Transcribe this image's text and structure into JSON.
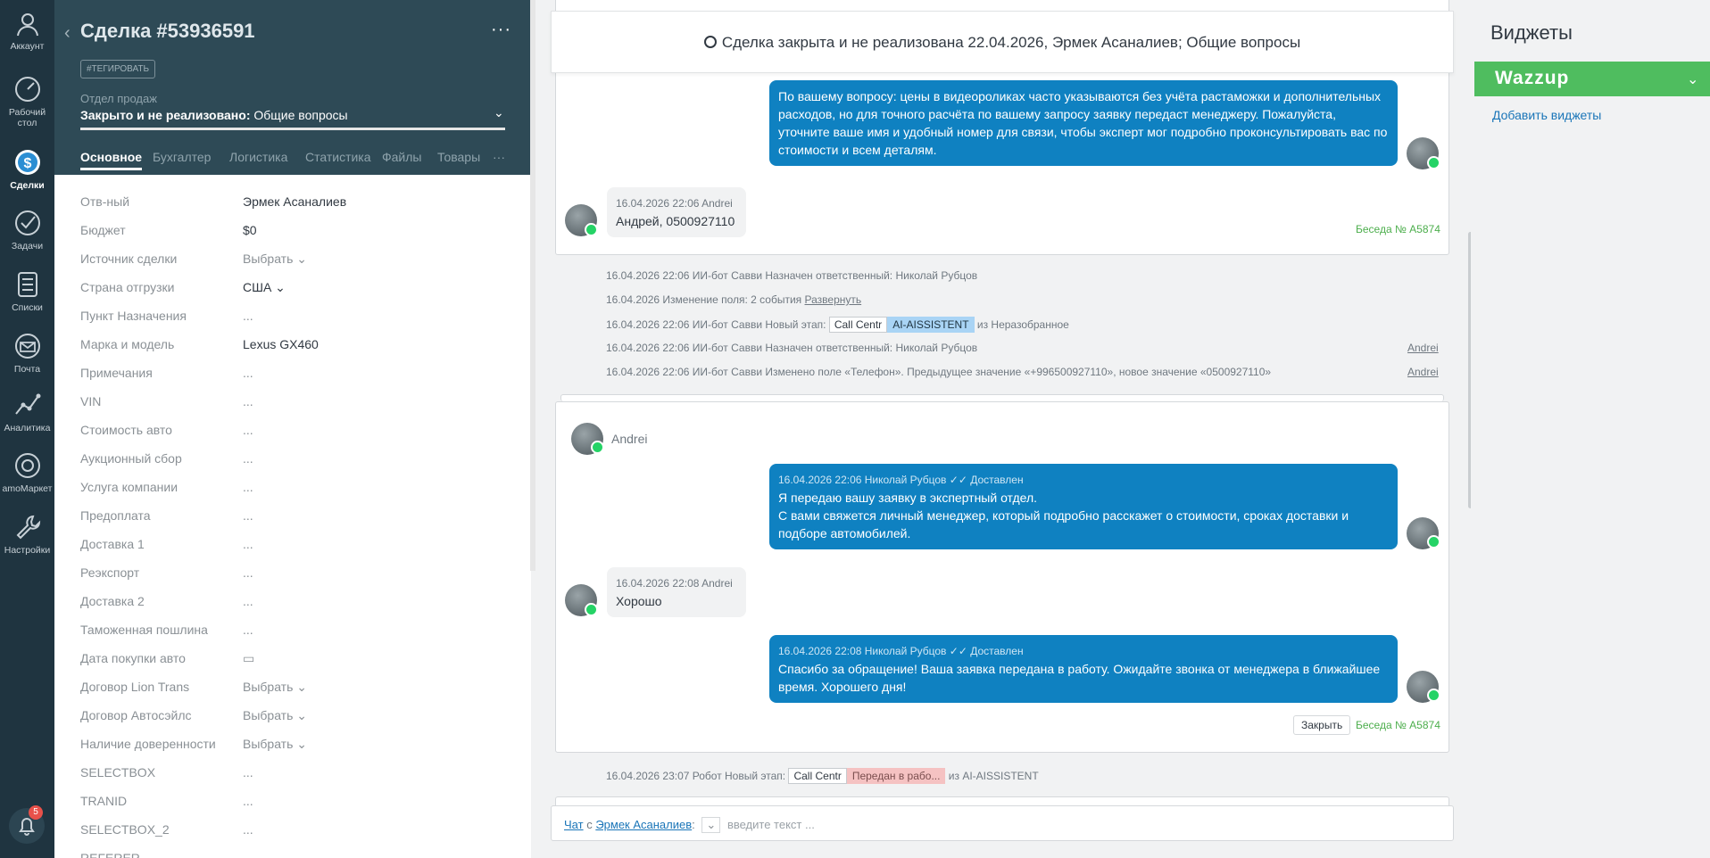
{
  "nav": {
    "items": [
      {
        "label": "Аккаунт",
        "icon": "account-icon"
      },
      {
        "label": "Рабочий стол",
        "icon": "dashboard-icon"
      },
      {
        "label": "Сделки",
        "icon": "deals-icon"
      },
      {
        "label": "Задачи",
        "icon": "tasks-icon"
      },
      {
        "label": "Списки",
        "icon": "lists-icon"
      },
      {
        "label": "Почта",
        "icon": "mail-icon"
      },
      {
        "label": "Аналитика",
        "icon": "analytics-icon"
      },
      {
        "label": "amoМаркет",
        "icon": "market-icon"
      },
      {
        "label": "Настройки",
        "icon": "settings-icon"
      }
    ],
    "notifications_count": "5"
  },
  "deal": {
    "title": "Сделка #53936591",
    "tag_button": "#ТЕГИРОВАТЬ",
    "pipeline": "Отдел продаж",
    "status_bold": "Закрыто и не реализовано:",
    "status_rest": " Общие вопросы",
    "tabs": [
      "Основное",
      "Бухгалтер",
      "Логистика",
      "Статистика",
      "Файлы",
      "Товары"
    ],
    "fields": [
      {
        "label": "Отв-ный",
        "value": "Эрмек Асаналиев"
      },
      {
        "label": "Бюджет",
        "value": "$0"
      },
      {
        "label": "Источник сделки",
        "value": "Выбрать ⌄"
      },
      {
        "label": "Страна отгрузки",
        "value": "США ⌄"
      },
      {
        "label": "Пункт Назначения",
        "value": "..."
      },
      {
        "label": "Марка и модель",
        "value": "Lexus GX460"
      },
      {
        "label": "Примечания",
        "value": "..."
      },
      {
        "label": "VIN",
        "value": "..."
      },
      {
        "label": "Стоимость авто",
        "value": "..."
      },
      {
        "label": "Аукционный сбор",
        "value": "..."
      },
      {
        "label": "Услуга компании",
        "value": "..."
      },
      {
        "label": "Предоплата",
        "value": "..."
      },
      {
        "label": "Доставка 1",
        "value": "..."
      },
      {
        "label": "Реэкспорт",
        "value": "..."
      },
      {
        "label": "Доставка 2",
        "value": "..."
      },
      {
        "label": "Таможенная пошлина",
        "value": "..."
      },
      {
        "label": "Дата покупки авто",
        "value": "▭"
      },
      {
        "label": "Договор Lion Trans",
        "value": "Выбрать ⌄"
      },
      {
        "label": "Договор Автосэйлс",
        "value": "Выбрать ⌄"
      },
      {
        "label": "Наличие доверенности",
        "value": "Выбрать ⌄"
      },
      {
        "label": "SELECTBOX",
        "value": "..."
      },
      {
        "label": "TRANID",
        "value": "..."
      },
      {
        "label": "SELECTBOX_2",
        "value": "..."
      },
      {
        "label": "REFERER",
        "value": ""
      }
    ]
  },
  "feed": {
    "closed_banner": "Сделка закрыта и не реализована 22.04.2026, Эрмек Асаналиев; Общие вопросы",
    "msg1": "По вашему вопросу: цены в видеороликах часто указываются без учёта растаможки и дополнительных расходов, но для точного расчёта по вашему запросу заявку передаст менеджеру. Пожалуйста, уточните ваше имя и удобный номер для связи, чтобы эксперт мог подробно проконсультировать вас по стоимости и всем деталям.",
    "msg2_meta": "16.04.2026 22:06 Andrei",
    "msg2": "Андрей, 0500927110",
    "conv1": "Беседа № A5874",
    "n1": "16.04.2026 22:06 ИИ-бот Савви Назначен ответственный: Николай Рубцов",
    "n2_text": "16.04.2026 Изменение поля: 2 события ",
    "n2_link": "Развернуть",
    "n3_pre": "16.04.2026 22:06 ИИ-бот Савви Новый этап: ",
    "n3_chip1": "Call Centr",
    "n3_chip2": "AI-AISSISTENT",
    "n3_post": " из Неразобранное",
    "n4": "16.04.2026 22:06 ИИ-бот Савви Назначен ответственный: Николай Рубцов",
    "n4_author": "Andrei",
    "n5": "16.04.2026 22:06 ИИ-бот Савви Изменено поле «Телефон». Предыдущее значение «+996500927110», новое значение «0500927110»",
    "n5_author": "Andrei",
    "contact_name": "Andrei",
    "m3_meta": "16.04.2026 22:06 Николай Рубцов  ✓✓ Доставлен",
    "m3_l1": "Я передаю вашу заявку в экспертный отдел.",
    "m3_l2": "С вами свяжется личный менеджер, который подробно расскажет о стоимости, сроках доставки и подборе автомобилей.",
    "m4_meta": "16.04.2026 22:08 Andrei",
    "m4": "Хорошо",
    "m5_meta": "16.04.2026 22:08 Николай Рубцов  ✓✓ Доставлен",
    "m5": "Спасибо за обращение! Ваша заявка передана в работу. Ожидайте звонка от менеджера в ближайшее время. Хорошего дня!",
    "close_btn": "Закрыть",
    "conv2": "Беседа № A5874",
    "n6_pre": "16.04.2026 23:07 Робот Новый этап: ",
    "n6_chip1": "Call Centr",
    "n6_chip2": "Передан в рабо...",
    "n6_post": " из AI-AISSISTENT",
    "chat_link": "Чат",
    "chat_with": " с ",
    "chat_contact": "Эрмек Асаналиев",
    "chat_colon": ":",
    "chat_placeholder": "введите текст ..."
  },
  "widgets": {
    "title": "Виджеты",
    "wazzup": "Wazzup",
    "add": "Добавить виджеты"
  }
}
